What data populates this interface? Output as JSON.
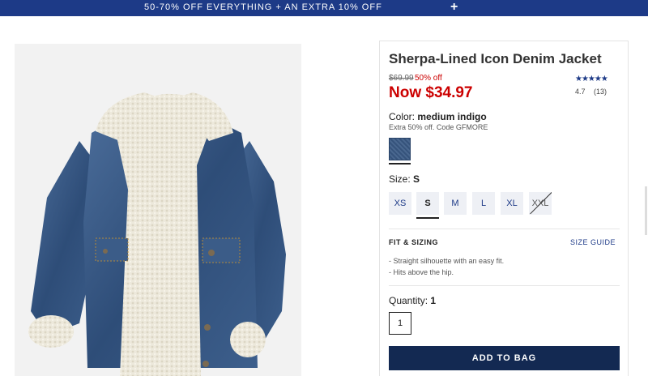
{
  "promo": {
    "text": "50-70% OFF EVERYTHING + AN EXTRA 10% OFF",
    "expand_symbol": "+"
  },
  "product": {
    "title": "Sherpa-Lined Icon Denim Jacket",
    "rating": {
      "stars": "★★★★★",
      "score": "4.7",
      "count": "(13)"
    },
    "price": {
      "original": "$69.99",
      "discount": "50% off",
      "now": "Now $34.97"
    },
    "color": {
      "label": "Color:",
      "value": "medium indigo",
      "note": "Extra 50% off. Code GFMORE",
      "swatch_color": "#3a5a86"
    },
    "size": {
      "label": "Size:",
      "value": "S",
      "options": [
        {
          "label": "XS",
          "state": "available"
        },
        {
          "label": "S",
          "state": "selected"
        },
        {
          "label": "M",
          "state": "available"
        },
        {
          "label": "L",
          "state": "available"
        },
        {
          "label": "XL",
          "state": "available"
        },
        {
          "label": "XXL",
          "state": "unavailable"
        }
      ]
    },
    "fit": {
      "title": "FIT & SIZING",
      "guide_link": "SIZE GUIDE",
      "items": [
        "- Straight silhouette with an easy fit.",
        "- Hits above the hip."
      ]
    },
    "quantity": {
      "label": "Quantity:",
      "value": "1"
    },
    "add_to_bag": "ADD TO BAG"
  },
  "colors": {
    "promo_bar": "#1d3a87",
    "sale_red": "#cc0000",
    "button_navy": "#132952"
  }
}
